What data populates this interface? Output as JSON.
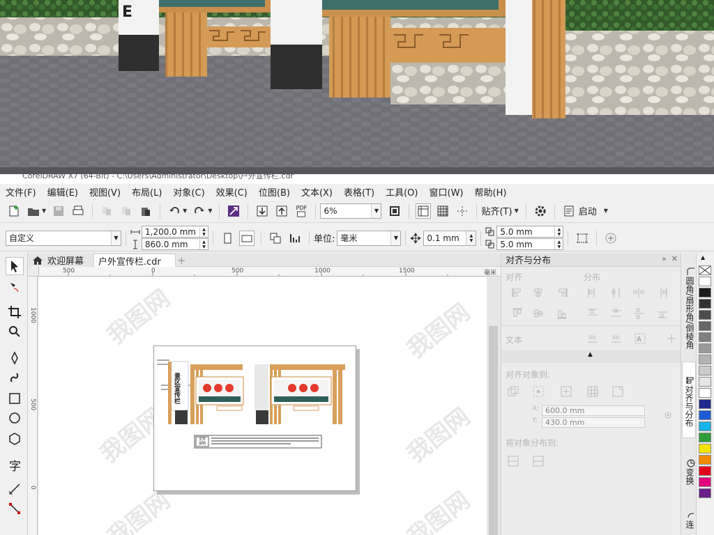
{
  "photo": {
    "sign_glyph": "E"
  },
  "window": {
    "title": "CorelDRAW X7 (64-Bit) - C:\\Users\\Administrator\\Desktop\\户外宣传栏.cdr"
  },
  "menu": [
    "文件(F)",
    "编辑(E)",
    "视图(V)",
    "布局(L)",
    "对象(C)",
    "效果(C)",
    "位图(B)",
    "文本(X)",
    "表格(T)",
    "工具(O)",
    "窗口(W)",
    "帮助(H)"
  ],
  "toolbar1": {
    "zoom_value": "6%",
    "snap_label": "贴齐(T)",
    "launch_label": "启动",
    "pdf_label": "PDF"
  },
  "toolbar2": {
    "page_preset": "自定义",
    "width": "1,200.0 mm",
    "height": "860.0 mm",
    "unit_label": "单位:",
    "unit_value": "毫米",
    "nudge": "0.1 mm",
    "dup_x": "5.0 mm",
    "dup_y": "5.0 mm"
  },
  "doctabs": {
    "home": "欢迎屏幕",
    "file": "户外宣传栏.cdr",
    "add": "+"
  },
  "ruler": {
    "h": [
      "500",
      "0",
      "500",
      "1000",
      "1500",
      "毫米"
    ],
    "v": [
      "1000",
      "500",
      "0"
    ]
  },
  "artwork": {
    "vertical_title": "景区宣传栏",
    "caption_label": "文件\n说明"
  },
  "watermark": "我图网",
  "docker": {
    "title": "对齐与分布",
    "align_label": "对齐",
    "distribute_label": "分布",
    "text_label": "文本",
    "align_to_label": "对齐对象到:",
    "x_value": "600.0 mm",
    "y_value": "430.0 mm",
    "x_label": "X:",
    "y_label": "Y:",
    "distribute_to_label": "将对象分布到:"
  },
  "sidetabs": [
    "圆角/扇形角/倒棱角",
    "对齐与分布",
    "变换",
    "连"
  ],
  "palette": [
    "#ffffff",
    "#1a1a1a",
    "#333333",
    "#4d4d4d",
    "#666666",
    "#808080",
    "#999999",
    "#b3b3b3",
    "#cccccc",
    "#e6e6e6",
    "#ffffff",
    "#1f2a8c",
    "#1e5bd6",
    "#18b4e8",
    "#2e9e3a",
    "#f5e400",
    "#f08a00",
    "#e3001b",
    "#e4007f",
    "#6a1f8a"
  ],
  "colors": {
    "wood": "#d8a05a",
    "stone": "#cfcfcf",
    "grass": "#3f6b33",
    "pavement": "#6f6f74",
    "brand": "#e3001b"
  }
}
